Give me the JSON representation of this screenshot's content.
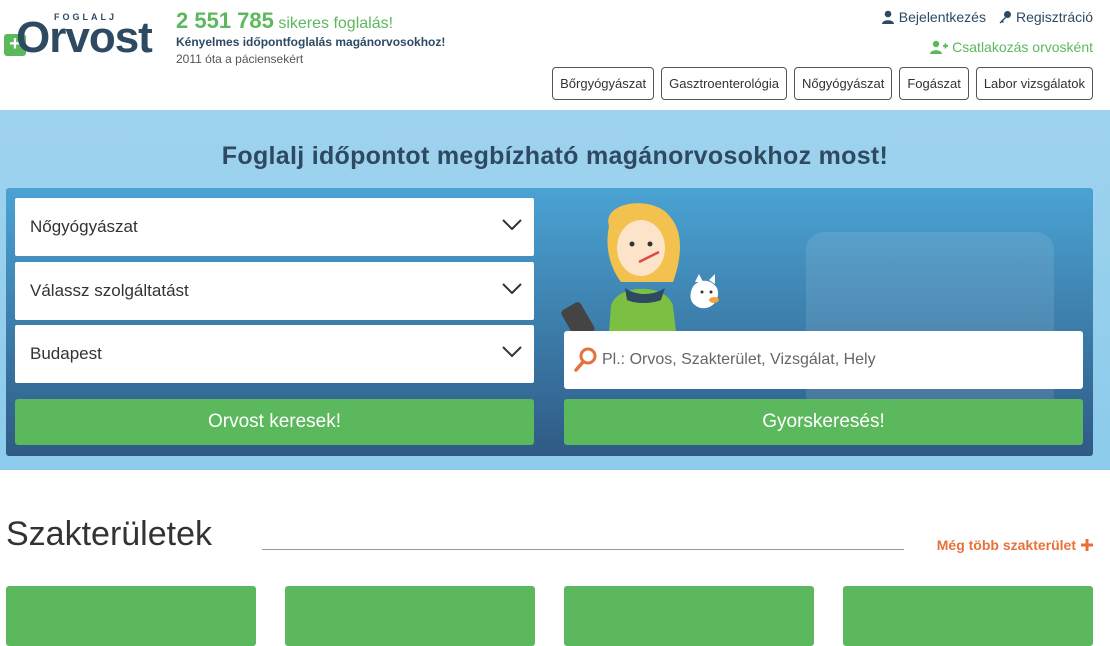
{
  "logo": {
    "small": "FOGLALJ",
    "big": "Orvost",
    "plus": "+"
  },
  "stats": {
    "count": "2 551 785",
    "count_suffix": "sikeres foglalás!",
    "tagline": "Kényelmes időpontfoglalás magánorvosokhoz!",
    "since": "2011 óta a páciensekért"
  },
  "top_links": {
    "login": "Bejelentkezés",
    "register": "Regisztráció",
    "join": "Csatlakozás orvosként"
  },
  "quick_tags": [
    "Bőrgyógyászat",
    "Gasztroenterológia",
    "Nőgyógyászat",
    "Fogászat",
    "Labor vizsgálatok"
  ],
  "hero": {
    "title": "Foglalj időpontot megbízható magánorvosokhoz most!",
    "specialty_select": "Nőgyógyászat",
    "service_select": "Válassz szolgáltatást",
    "city_select": "Budapest",
    "search_button": "Orvost keresek!",
    "quick_search_placeholder": "Pl.: Orvos, Szakterület, Vizsgálat, Hely",
    "quick_search_button": "Gyorskeresés!"
  },
  "specialties": {
    "title": "Szakterületek",
    "more": "Még több szakterület"
  },
  "colors": {
    "brand_green": "#5cb85c",
    "brand_navy": "#2e4a62",
    "accent_orange": "#e8713a"
  },
  "icons": [
    "user-icon",
    "key-icon",
    "user-plus-icon",
    "chevron-down-icon",
    "search-icon",
    "plus-icon"
  ]
}
